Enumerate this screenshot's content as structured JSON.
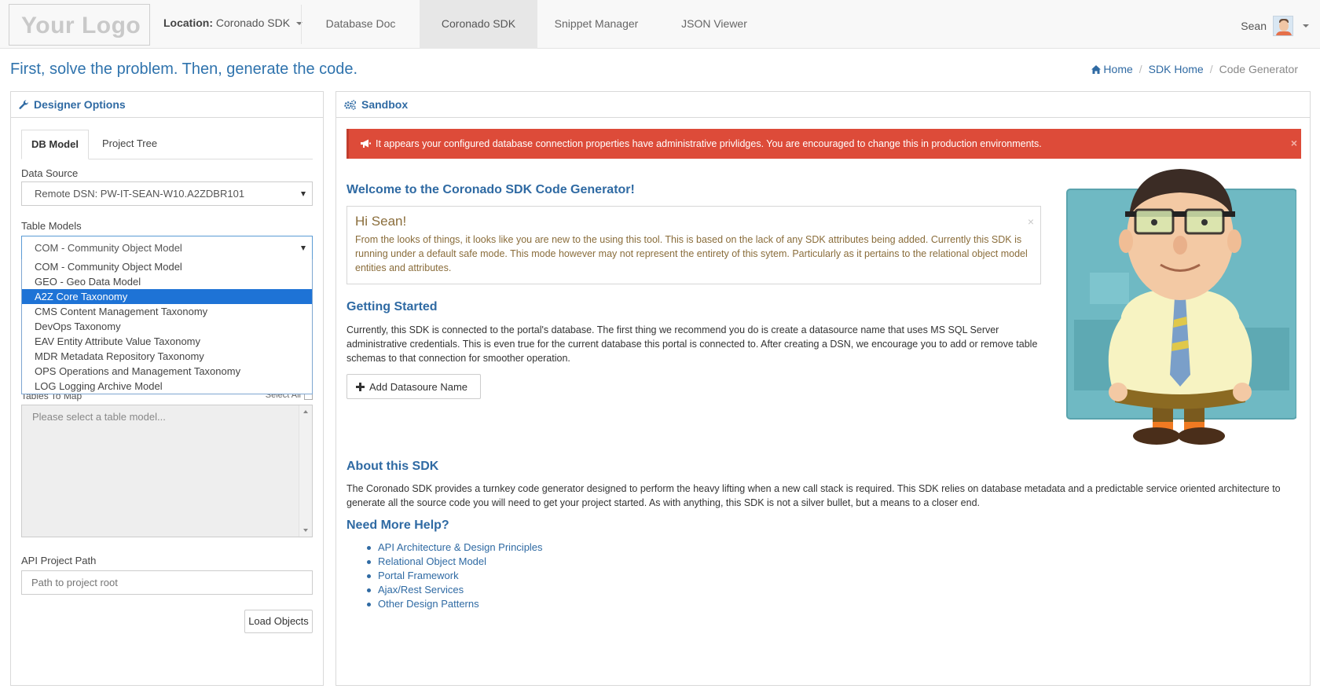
{
  "navbar": {
    "logo": "Your Logo",
    "location_label": "Location:",
    "location_value": "Coronado SDK",
    "tabs": [
      {
        "label": "Database Doc"
      },
      {
        "label": "Coronado SDK"
      },
      {
        "label": "Snippet Manager"
      },
      {
        "label": "JSON Viewer"
      }
    ],
    "user_name": "Sean"
  },
  "header": {
    "tagline": "First, solve the problem. Then, generate the code.",
    "breadcrumb": [
      "Home",
      "SDK Home",
      "Code Generator"
    ]
  },
  "designer": {
    "title": "Designer Options",
    "tabs": [
      "DB Model",
      "Project Tree"
    ],
    "data_source_label": "Data Source",
    "data_source_value": "Remote DSN: PW-IT-SEAN-W10.A2ZDBR101",
    "table_models_label": "Table Models",
    "table_models_value": "COM - Community Object Model",
    "table_models_options": [
      "COM - Community Object Model",
      "GEO - Geo Data Model",
      "A2Z Core Taxonomy",
      "CMS Content Management Taxonomy",
      "DevOps Taxonomy",
      "EAV Entity Attribute Value Taxonomy",
      "MDR Metadata Repository Taxonomy",
      "OPS Operations and Management Taxonomy",
      "LOG Logging Archive Model"
    ],
    "highlighted_option": "A2Z Core Taxonomy",
    "tables_label": "Tables To Map",
    "select_all_label": "Select All",
    "tables_placeholder": "Please select a table model...",
    "api_path_label": "API Project Path",
    "api_path_placeholder": "Path to project root",
    "load_button": "Load Objects"
  },
  "sandbox": {
    "title": "Sandbox",
    "alert": "It appears your configured database connection properties have administrative privlidges. You are encouraged to change this in production environments.",
    "welcome_title": "Welcome to the Coronado SDK Code Generator!",
    "greeting": "Hi Sean!",
    "welcome_msg": "From the looks of things, it looks like you are new to the using this tool. This is based on the lack of any SDK attributes being added. Currently this SDK is running under a default safe mode. This mode however may not represent the entirety of this sytem. Particularly as it pertains to the relational object model entities and attributes.",
    "getting_started_title": "Getting Started",
    "getting_started_text": "Currently, this SDK is connected to the portal's database. The first thing we recommend you do is create a datasource name that uses MS SQL Server administrative credentials. This is even true for the current database this portal is connected to. After creating a DSN, we encourage you to add or remove table schemas to that connection for smoother operation.",
    "add_button": "Add Datasoure Name",
    "about_title": "About this SDK",
    "about_text": "The Coronado SDK provides a turnkey code generator designed to perform the heavy lifting when a new call stack is required. This SDK relies on database metadata and a predictable service oriented architecture to generate all the source code you will need to get your project started. As with anything, this SDK is not a silver bullet, but a means to a closer end.",
    "help_title": "Need More Help?",
    "help_links": [
      "API Architecture & Design Principles",
      "Relational Object Model",
      "Portal Framework",
      "Ajax/Rest Services",
      "Other Design Patterns"
    ]
  },
  "colors": {
    "accent": "#2f6aa3",
    "alert": "#dd4b39",
    "selected": "#1e73d6"
  }
}
